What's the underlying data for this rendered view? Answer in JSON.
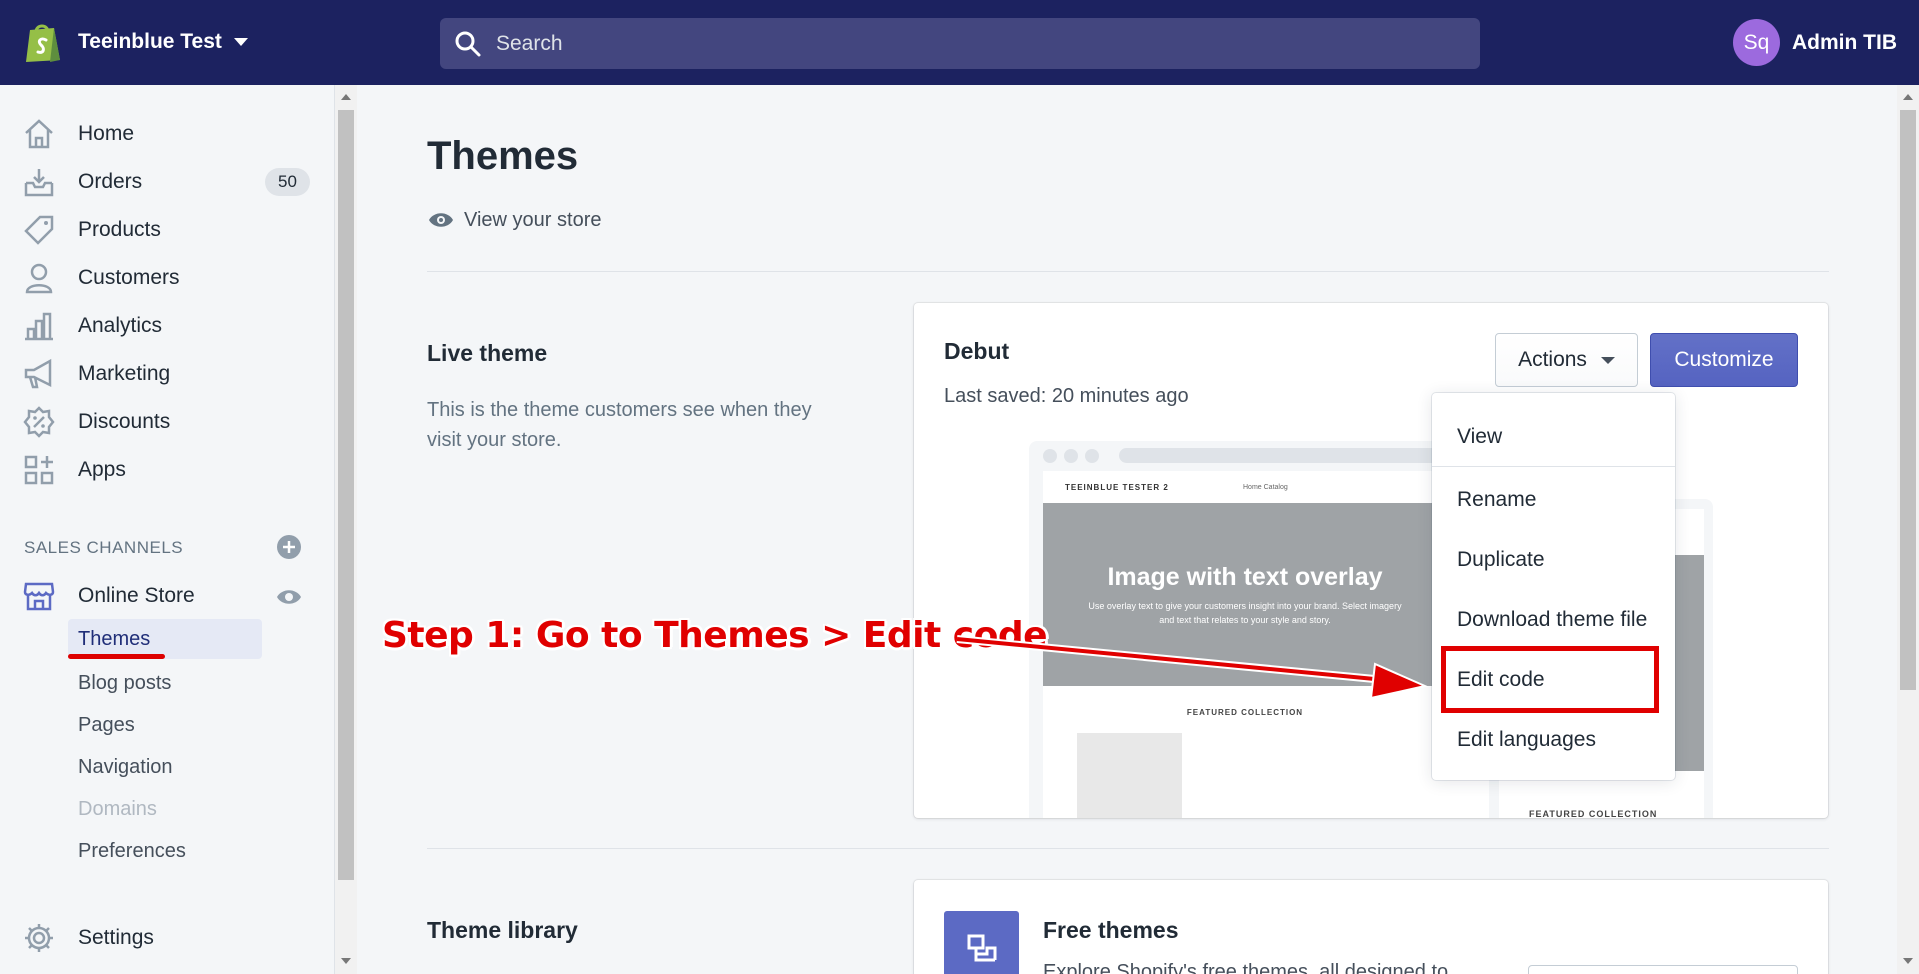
{
  "topbar": {
    "store_name": "Teeinblue Test",
    "search_placeholder": "Search",
    "avatar_initials": "Sq",
    "user_name": "Admin TIB"
  },
  "sidebar": {
    "items": [
      {
        "label": "Home",
        "icon": "home-icon"
      },
      {
        "label": "Orders",
        "icon": "orders-icon",
        "badge": "50"
      },
      {
        "label": "Products",
        "icon": "tag-icon"
      },
      {
        "label": "Customers",
        "icon": "person-icon"
      },
      {
        "label": "Analytics",
        "icon": "bar-chart-icon"
      },
      {
        "label": "Marketing",
        "icon": "megaphone-icon"
      },
      {
        "label": "Discounts",
        "icon": "discount-icon"
      },
      {
        "label": "Apps",
        "icon": "apps-grid-icon"
      }
    ],
    "sales_channels_title": "SALES CHANNELS",
    "online_store": "Online Store",
    "sub_items": [
      "Themes",
      "Blog posts",
      "Pages",
      "Navigation",
      "Domains",
      "Preferences"
    ],
    "settings": "Settings"
  },
  "main": {
    "title": "Themes",
    "view_store": "View your store",
    "live_theme": {
      "heading": "Live theme",
      "description": "This is the theme customers see when they visit your store.",
      "theme_name": "Debut",
      "last_saved": "Last saved: 20 minutes ago",
      "actions_label": "Actions",
      "customize_label": "Customize"
    },
    "preview": {
      "store_title": "TEEINBLUE TESTER 2",
      "nav": "Home   Catalog",
      "hero_title": "Image with text overlay",
      "hero_sub": "Use overlay text to give your customers insight into your brand. Select imagery and text that relates to your style and story.",
      "featured": "FEATURED COLLECTION"
    },
    "dropdown": [
      "View",
      "Rename",
      "Duplicate",
      "Download theme file",
      "Edit code",
      "Edit languages"
    ],
    "theme_library": {
      "heading": "Theme library",
      "free_title": "Free themes",
      "free_desc": "Explore Shopify's free themes, all designed to"
    }
  },
  "annotation": {
    "text": "Step 1: Go to Themes > Edit code",
    "color": "#e00000"
  }
}
